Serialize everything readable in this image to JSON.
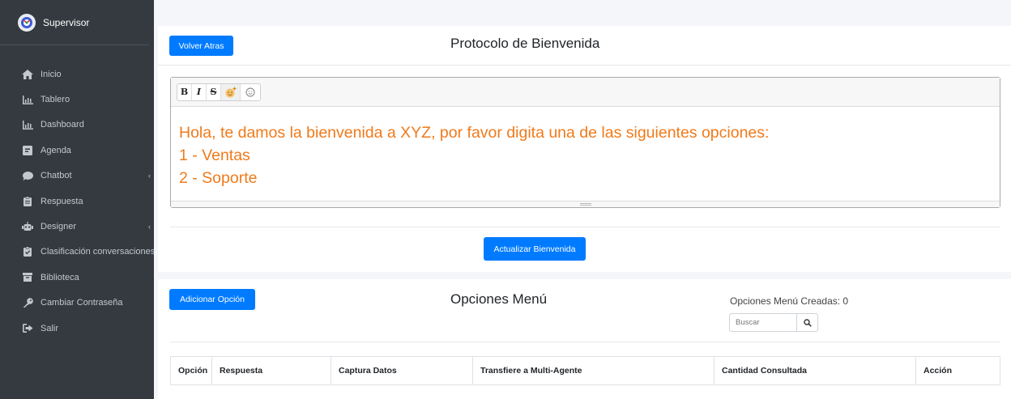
{
  "sidebar": {
    "brand": "Supervisor",
    "items": [
      {
        "label": "Inicio",
        "icon": "home-icon",
        "caret": ""
      },
      {
        "label": "Tablero",
        "icon": "chart-area-icon",
        "caret": ""
      },
      {
        "label": "Dashboard",
        "icon": "chart-area-icon",
        "caret": ""
      },
      {
        "label": "Agenda",
        "icon": "calendar-icon",
        "caret": ""
      },
      {
        "label": "Chatbot",
        "icon": "comment-icon",
        "caret": "‹"
      },
      {
        "label": "Respuesta",
        "icon": "clipboard-icon",
        "caret": ""
      },
      {
        "label": "Designer",
        "icon": "robot-icon",
        "caret": "‹"
      },
      {
        "label": "Clasificación conversaciones",
        "icon": "clipboard-check-icon",
        "caret": ""
      },
      {
        "label": "Biblioteca",
        "icon": "archive-icon",
        "caret": ""
      },
      {
        "label": "Cambiar Contraseña",
        "icon": "key-icon",
        "caret": ""
      },
      {
        "label": "Salir",
        "icon": "sign-out-icon",
        "caret": ""
      }
    ]
  },
  "welcome": {
    "back_button": "Volver Atras",
    "title": "Protocolo de Bienvenida",
    "toolbar": {
      "bold": "B",
      "italic": "I",
      "strike": "S"
    },
    "lines": [
      "Hola, te damos la bienvenida a XYZ, por favor digita una de las siguientes opciones:",
      "1 - Ventas",
      "2 - Soporte"
    ],
    "update_button": "Actualizar Bienvenida"
  },
  "menu": {
    "add_button": "Adicionar Opción",
    "title": "Opciones Menú",
    "count_label": "Opciones Menú Creadas: 0",
    "search_placeholder": "Buscar",
    "columns": [
      "Opción",
      "Respuesta",
      "Captura Datos",
      "Transfiere a Multi-Agente",
      "Cantidad Consultada",
      "Acción"
    ]
  },
  "colors": {
    "sidebar_bg": "#343a40",
    "primary": "#007bff",
    "editor_text": "#f07a1a"
  }
}
